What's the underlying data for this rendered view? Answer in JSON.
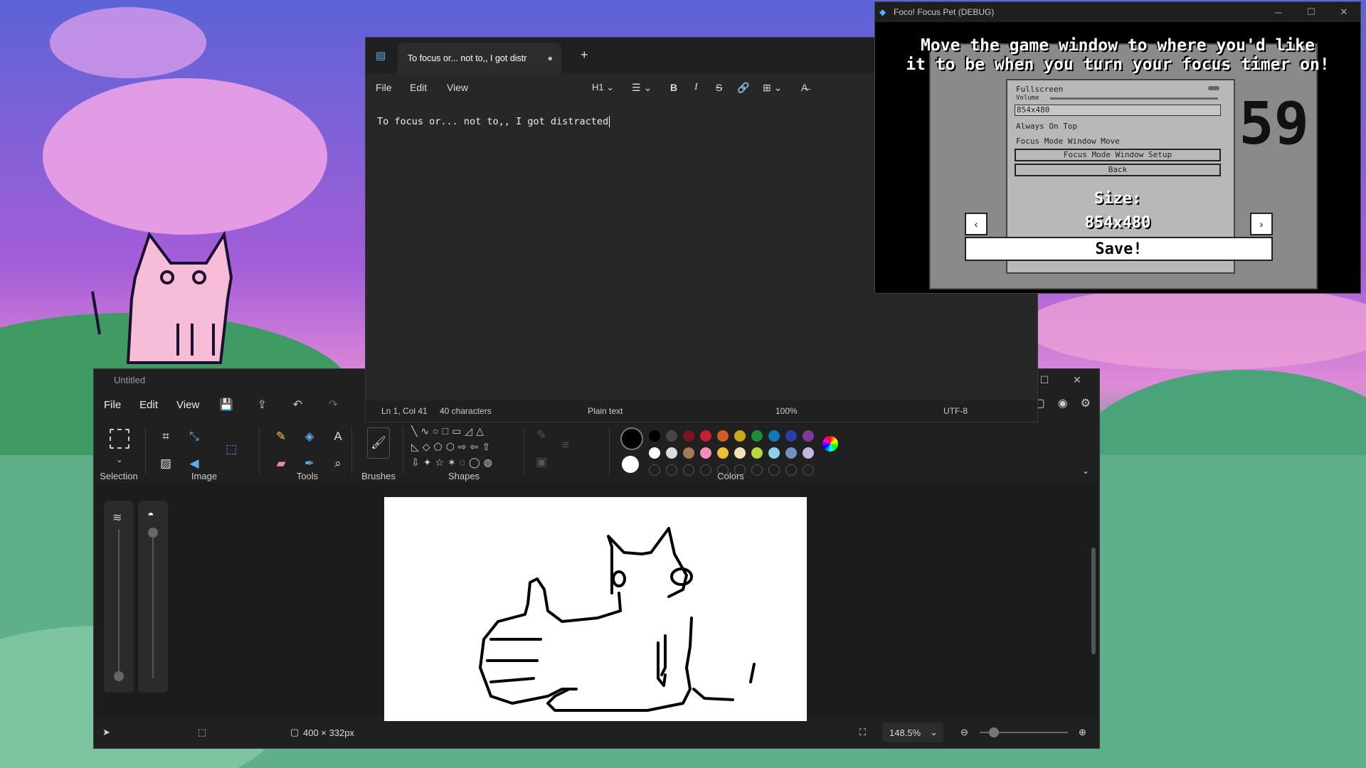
{
  "paint": {
    "title": "Untitled",
    "menu": [
      "File",
      "Edit",
      "View"
    ],
    "groups": {
      "selection": "Selection",
      "image": "Image",
      "tools": "Tools",
      "brushes": "Brushes",
      "shapes": "Shapes",
      "colors": "Colors"
    },
    "status": {
      "canvas_size": "400 × 332px",
      "zoom": "148.5%"
    },
    "palette_row1": [
      "#000000",
      "#464646",
      "#7a1420",
      "#c4212f",
      "#d05d22",
      "#c9a71d",
      "#1e8b39",
      "#1477b8",
      "#2c3fa9",
      "#7b3b96"
    ],
    "palette_row2": [
      "#ffffff",
      "#dcdcdc",
      "#a5795a",
      "#f28fb8",
      "#efbe39",
      "#efe4b0",
      "#b5d742",
      "#8ccfea",
      "#7190c5",
      "#c4b8e3"
    ]
  },
  "notepad": {
    "tab_title": "To focus or... not to,, I got distr",
    "menu": [
      "File",
      "Edit",
      "View"
    ],
    "heading_menu": "H1",
    "text": "To focus or... not to,, I got distracted",
    "status": {
      "position": "Ln 1, Col 41",
      "chars": "40 characters",
      "format": "Plain text",
      "zoom": "100%",
      "encoding": "UTF-8"
    }
  },
  "game": {
    "title": "Foco! Focus Pet (DEBUG)",
    "instruction_1": "Move the game window to where you'd like",
    "instruction_2": "it to be when you turn your focus timer on!",
    "settings": {
      "fullscreen": "Fullscreen",
      "volume": "Volume",
      "resolution": "854x480",
      "always_on_top": "Always On Top",
      "focus_mode_move": "Focus Mode Window Move",
      "focus_setup": "Focus Mode Window Setup",
      "back": "Back"
    },
    "size_label": "Size:",
    "size_value": "854x480",
    "save": "Save!"
  }
}
